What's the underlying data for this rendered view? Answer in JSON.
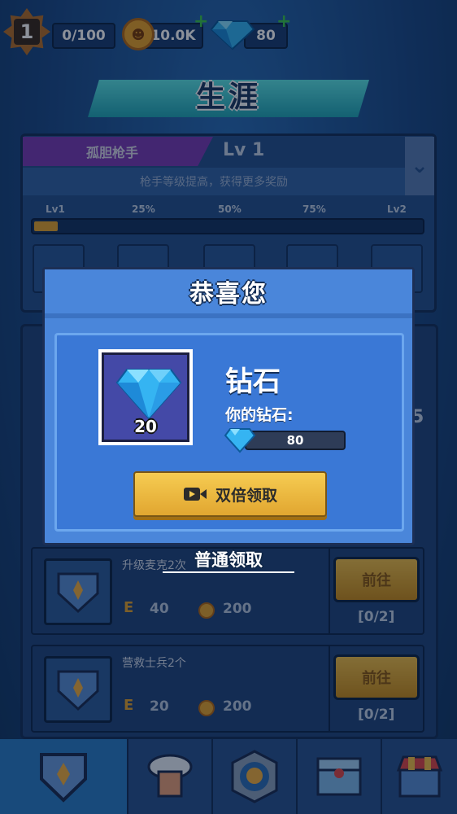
{
  "topbar": {
    "rank_level": "1",
    "exp_value": "0/100",
    "coins_value": "10.0K",
    "gems_value": "80",
    "icons": [
      "rank-star-icon",
      "coin-icon",
      "diamond-icon",
      "plus-icon"
    ]
  },
  "career": {
    "title": "生涯"
  },
  "gunner": {
    "tag": "孤胆枪手",
    "level": "Lv 1",
    "subtitle": "枪手等级提高，获得更多奖励",
    "progress_labels": [
      "Lv1",
      "25%",
      "50%",
      "75%",
      "Lv2"
    ],
    "progress_fraction": 0.06
  },
  "tasks": [
    {
      "name": "升级麦克2次",
      "exp": "40",
      "coins": "200",
      "button": "前往",
      "progress": "[0/2]"
    },
    {
      "name": "营救士兵2个",
      "exp": "20",
      "coins": "200",
      "button": "前往",
      "progress": "[0/2]"
    }
  ],
  "side_number": "5",
  "modal": {
    "title": "恭喜您",
    "item_name": "钻石",
    "item_count": "20",
    "gem_label": "你的钻石:",
    "gem_value": "80",
    "double_button": "双倍领取",
    "normal_claim": "普通领取"
  },
  "colors": {
    "accent_gold": "#e1a630",
    "modal_blue": "#4a86da",
    "background": "#1f4a86"
  }
}
